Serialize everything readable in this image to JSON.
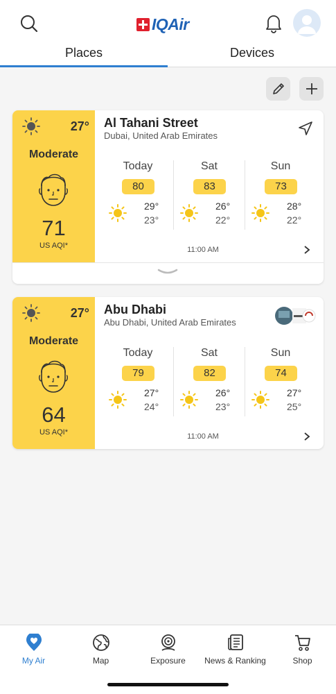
{
  "header": {
    "brand": "IQAir"
  },
  "tabs": [
    {
      "label": "Places",
      "active": true
    },
    {
      "label": "Devices",
      "active": false
    }
  ],
  "colors": {
    "accent": "#2f7fd0",
    "moderate": "#fcd34a",
    "brand_red": "#e0202e",
    "brand_blue": "#1f62b5"
  },
  "places": [
    {
      "name": "Al Tahani Street",
      "location": "Dubai, United Arab Emirates",
      "temp": "27°",
      "level": "Moderate",
      "aqi": "71",
      "aqi_unit": "US AQI*",
      "icon": "location-arrow-icon",
      "forecast": [
        {
          "day": "Today",
          "aqi": "80",
          "high": "29°",
          "low": "23°"
        },
        {
          "day": "Sat",
          "aqi": "83",
          "high": "26°",
          "low": "22°"
        },
        {
          "day": "Sun",
          "aqi": "73",
          "high": "28°",
          "low": "22°"
        }
      ],
      "updated": "11:00 AM"
    },
    {
      "name": "Abu Dhabi",
      "location": "Abu Dhabi, United Arab Emirates",
      "temp": "27°",
      "level": "Moderate",
      "aqi": "64",
      "aqi_unit": "US AQI*",
      "icon": "sponsor-logo",
      "forecast": [
        {
          "day": "Today",
          "aqi": "79",
          "high": "27°",
          "low": "24°"
        },
        {
          "day": "Sat",
          "aqi": "82",
          "high": "26°",
          "low": "23°"
        },
        {
          "day": "Sun",
          "aqi": "74",
          "high": "27°",
          "low": "25°"
        }
      ],
      "updated": "11:00 AM"
    }
  ],
  "bottom_nav": [
    {
      "label": "My Air",
      "icon": "heart-pin-icon",
      "active": true
    },
    {
      "label": "Map",
      "icon": "globe-icon",
      "active": false
    },
    {
      "label": "Exposure",
      "icon": "exposure-icon",
      "active": false
    },
    {
      "label": "News & Ranking",
      "icon": "newspaper-icon",
      "active": false
    },
    {
      "label": "Shop",
      "icon": "cart-icon",
      "active": false
    }
  ]
}
